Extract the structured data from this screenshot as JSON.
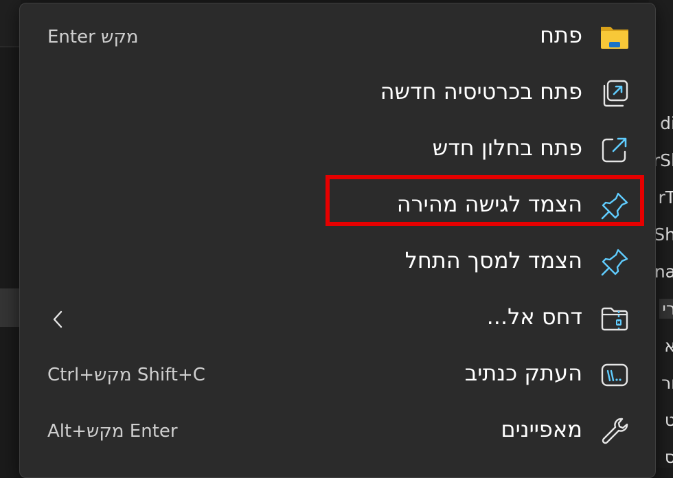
{
  "background": {
    "fragments": [
      "di",
      "rSl",
      "rT",
      "Sh",
      "na",
      "רי",
      "א",
      "ור",
      "ט",
      "ס"
    ]
  },
  "menu": {
    "items": [
      {
        "label": "פתח",
        "shortcut": "מקש Enter",
        "icon": "folder-icon"
      },
      {
        "label": "פתח בכרטיסיה חדשה",
        "shortcut": "",
        "icon": "open-in-new-tab-icon"
      },
      {
        "label": "פתח בחלון חדש",
        "shortcut": "",
        "icon": "open-in-new-window-icon"
      },
      {
        "label": "הצמד לגישה מהירה",
        "shortcut": "",
        "icon": "pin-icon",
        "highlighted": true
      },
      {
        "label": "הצמד למסך התחל",
        "shortcut": "",
        "icon": "pin-icon"
      },
      {
        "label": "דחס אל...",
        "shortcut": "",
        "icon": "zip-folder-icon",
        "submenu_icon": "chevron-left-icon"
      },
      {
        "label": "העתק כנתיב",
        "shortcut": "Ctrl+מקש Shift+C",
        "icon": "copy-path-icon"
      },
      {
        "label": "מאפיינים",
        "shortcut": "Alt+מקש Enter",
        "icon": "wrench-icon"
      }
    ]
  },
  "colors": {
    "menu_bg": "#2b2b2b",
    "text": "#ffffff",
    "shortcut_text": "#cfcfcf",
    "accent_icon": "#60cdff",
    "folder_yellow": "#f8c838",
    "highlight_border": "#e60000"
  }
}
